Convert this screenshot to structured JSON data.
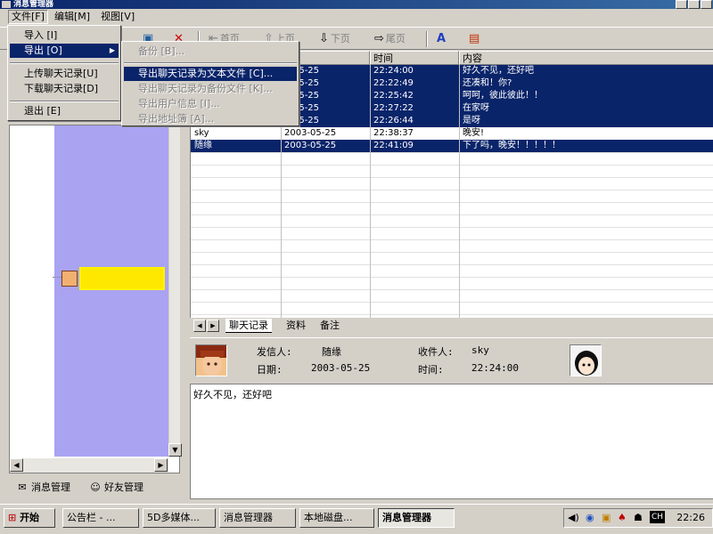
{
  "window": {
    "title": "消息管理器"
  },
  "menubar": {
    "file": "文件[F]",
    "edit": "编辑[M]",
    "view": "视图[V]"
  },
  "file_menu": {
    "import": "导入 [I]",
    "export": "导出 [O]",
    "upload": "上传聊天记录[U]",
    "download": "下载聊天记录[D]",
    "exit": "退出 [E]"
  },
  "export_submenu": {
    "backup": "备份 [B]...",
    "export_text": "导出聊天记录为文本文件 [C]...",
    "export_backup": "导出聊天记录为备份文件 [K]...",
    "export_user": "导出用户信息 [I]...",
    "export_address": "导出地址簿 [A]..."
  },
  "toolbar": {
    "first": "首页",
    "prev": "上页",
    "next": "下页",
    "last": "尾页"
  },
  "table": {
    "columns": [
      "",
      "期",
      "时间",
      "内容"
    ],
    "rows": [
      {
        "sender": "",
        "date": "3-05-25",
        "time": "22:24:00",
        "content": "好久不见，还好吧",
        "selected": true
      },
      {
        "sender": "",
        "date": "3-05-25",
        "time": "22:22:49",
        "content": "还凑和！你?",
        "selected": true
      },
      {
        "sender": "",
        "date": "3-05-25",
        "time": "22:25:42",
        "content": "呵呵，彼此彼此！！",
        "selected": true
      },
      {
        "sender": "",
        "date": "3-05-25",
        "time": "22:27:22",
        "content": "在家呀",
        "selected": true
      },
      {
        "sender": "",
        "date": "3-05-25",
        "time": "22:26:44",
        "content": "是呀",
        "selected": true
      },
      {
        "sender": "sky",
        "date": "2003-05-25",
        "time": "22:38:37",
        "content": "晚安!",
        "selected": false
      },
      {
        "sender": "随缘",
        "date": "2003-05-25",
        "time": "22:41:09",
        "content": "下了吗，晚安！！！！！",
        "selected": true
      }
    ]
  },
  "table_tabs": {
    "chat": "聊天记录",
    "info": "资料",
    "note": "备注"
  },
  "detail": {
    "sender_label": "发信人:",
    "sender": "随缘",
    "receiver_label": "收件人:",
    "receiver": "sky",
    "date_label": "日期:",
    "date": "2003-05-25",
    "time_label": "时间:",
    "time": "22:24:00",
    "message": "好久不见，还好吧"
  },
  "left_tabs": {
    "messages": "消息管理",
    "friends": "好友管理"
  },
  "taskbar": {
    "start": "开始",
    "tasks": [
      "公告栏 - ...",
      "5D多媒体...",
      "消息管理器",
      "本地磁盘...",
      "消息管理器"
    ],
    "clock": "22:26",
    "lang": "CH"
  },
  "colors": {
    "selection": "#0a246a",
    "panel_purple": "#a9a3f2",
    "highlight_yellow": "#ffe800"
  }
}
